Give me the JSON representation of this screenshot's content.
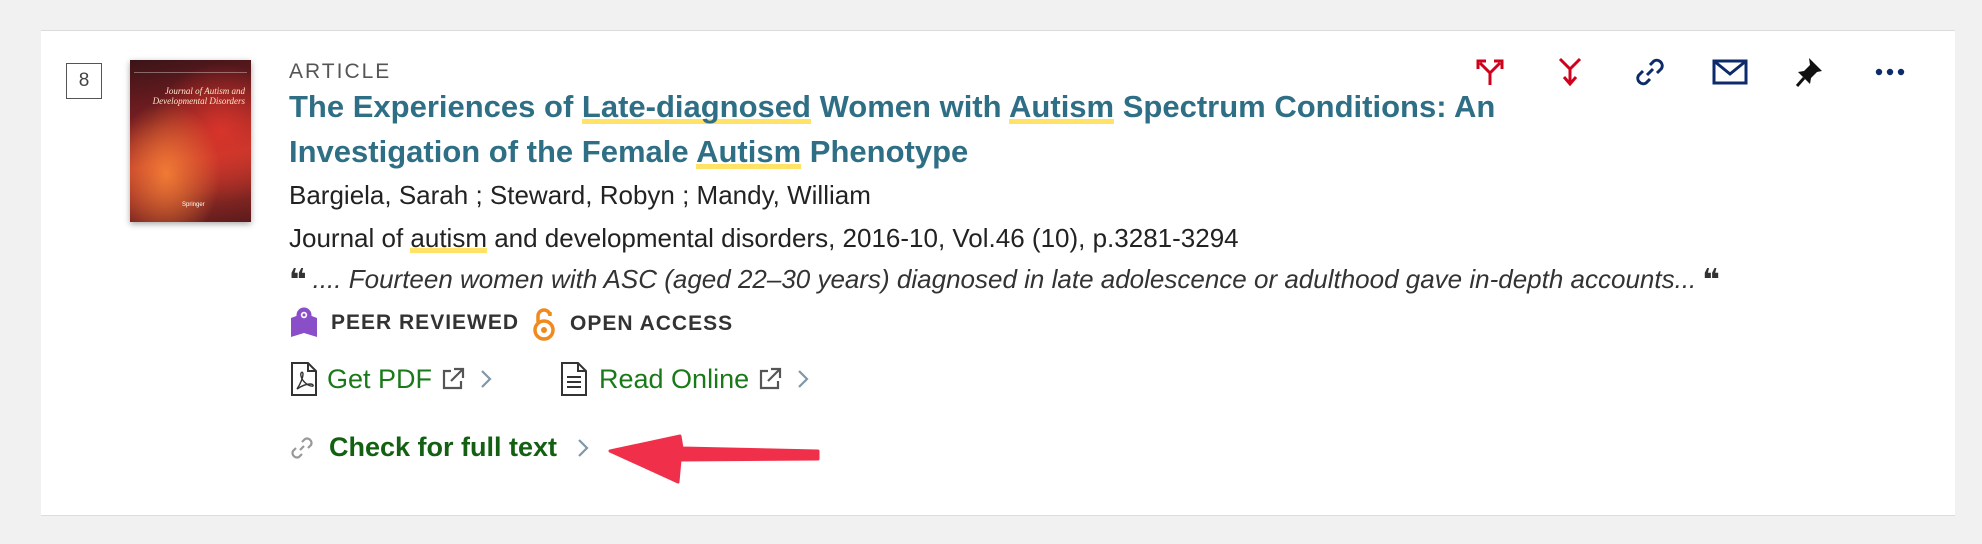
{
  "record": {
    "number": "8",
    "type": "ARTICLE",
    "title_parts": [
      {
        "text": "The Experiences of ",
        "highlight": false
      },
      {
        "text": "Late-diagnosed",
        "highlight": true
      },
      {
        "text": " Women with ",
        "highlight": false
      },
      {
        "text": "Autism",
        "highlight": true
      },
      {
        "text": " Spectrum Conditions: An",
        "highlight": false
      },
      {
        "br": true
      },
      {
        "text": "Investigation of the Female ",
        "highlight": false
      },
      {
        "text": "Autism",
        "highlight": true
      },
      {
        "text": " Phenotype",
        "highlight": false
      }
    ],
    "authors": "Bargiela, Sarah ; Steward, Robyn ; Mandy, William",
    "source_parts": [
      {
        "text": "Journal of ",
        "highlight": false
      },
      {
        "text": "autism",
        "highlight": true
      },
      {
        "text": " and developmental disorders, 2016-10, Vol.46 (10), p.3281-3294",
        "highlight": false
      }
    ],
    "snippet": ".... Fourteen women with ASC (aged 22–30 years) diagnosed in late adolescence or adulthood gave in-depth accounts...",
    "quote_mark": "❝",
    "cover": {
      "journal": "Journal of Autism and Developmental Disorders",
      "publisher": "Springer"
    }
  },
  "badges": {
    "peer_reviewed": "PEER REVIEWED",
    "open_access": "OPEN ACCESS"
  },
  "links": {
    "get_pdf": "Get PDF",
    "read_online": "Read Online",
    "check_full_text": "Check for full text"
  },
  "toolbar": {
    "icons": [
      "citation-export-icon",
      "cite-icon",
      "permalink-icon",
      "email-icon",
      "pin-icon",
      "more-icon"
    ]
  },
  "colors": {
    "title": "#2f6f86",
    "highlight": "#ffe266",
    "link_green": "#1a7a1a",
    "toolbar_red": "#d0021b",
    "toolbar_navy": "#0d2b6b",
    "peer_reviewed": "#8a4fc8",
    "open_access": "#f08a1c",
    "arrow": "#f0304a"
  }
}
